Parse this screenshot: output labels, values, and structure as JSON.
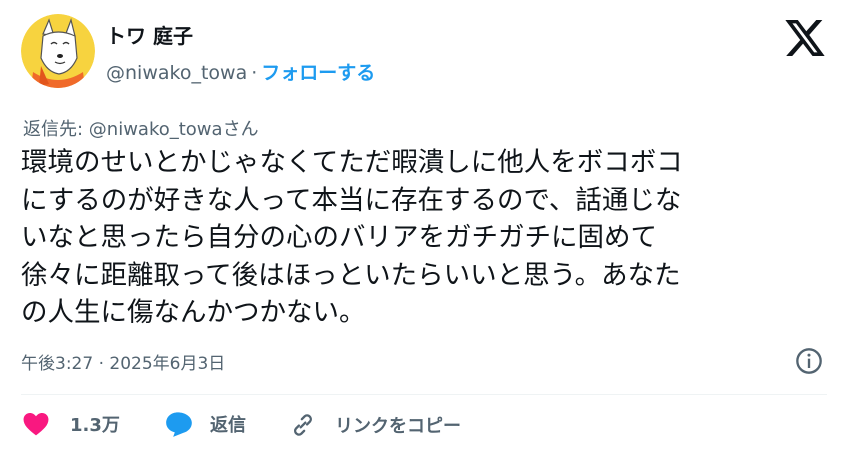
{
  "header": {
    "display_name": "トワ 庭子",
    "handle": "@niwako_towa",
    "separator": "·",
    "follow_label": "フォローする",
    "brand_icon": "x-logo-icon"
  },
  "tweet": {
    "reply_to": "返信先: @niwako_towaさん",
    "text": "環境のせいとかじゃなくてただ暇潰しに他人をボコボコ\nにするのが好きな人って本当に存在するので、話通じな\nいなと思ったら自分の心のバリアをガチガチに固めて\n徐々に距離取って後はほっといたらいいと思う。あなた\nの人生に傷なんかつかない。",
    "timestamp": "午後3:27 · 2025年6月3日",
    "info_icon": "info-icon"
  },
  "actions": {
    "like_count": "1.3万",
    "reply_label": "返信",
    "copy_link_label": "リンクをコピー",
    "like_color": "#f91880",
    "reply_color": "#1d9bf0"
  },
  "colors": {
    "accent": "#1d9bf0",
    "text": "#0f1419",
    "muted": "#536471",
    "avatar_bg": "#f7d33f"
  }
}
